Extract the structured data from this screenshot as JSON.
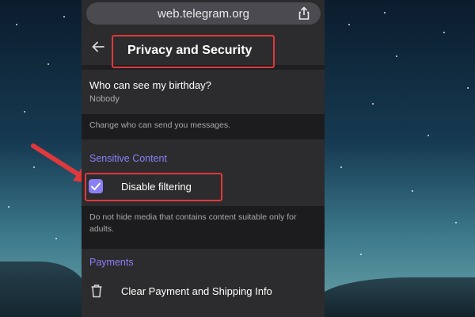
{
  "browser": {
    "url": "web.telegram.org",
    "share_icon": "share-icon"
  },
  "header": {
    "title": "Privacy and Security",
    "back_icon": "back-arrow-icon"
  },
  "birthday": {
    "title": "Who can see my birthday?",
    "value": "Nobody"
  },
  "messages_hint": "Change who can send you messages.",
  "sensitive_content": {
    "section_label": "Sensitive Content",
    "checkbox_label": "Disable filtering",
    "checked": true,
    "hint": "Do not hide media that contains content suitable only for adults."
  },
  "payments": {
    "section_label": "Payments",
    "clear_label": "Clear Payment and Shipping Info",
    "icon": "trash-icon"
  },
  "colors": {
    "accent": "#8b7ff7",
    "highlight": "#e0383b",
    "panel": "#2c2c2e"
  }
}
